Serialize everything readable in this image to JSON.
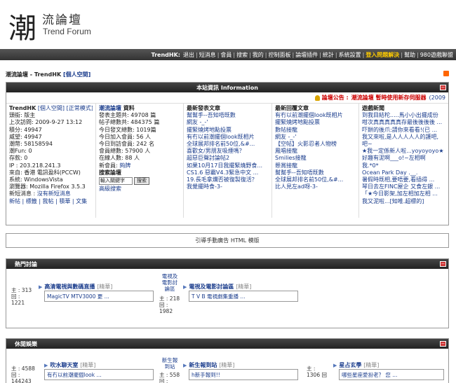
{
  "logo": {
    "glyph": "潮",
    "cn": "流論壇",
    "en": "Trend Forum"
  },
  "nav": {
    "items": [
      {
        "label": "TrendHK:",
        "style": "bold"
      },
      {
        "label": "退出"
      },
      {
        "label": "短消息"
      },
      {
        "label": "會員"
      },
      {
        "label": "搜索"
      },
      {
        "label": "我的"
      },
      {
        "label": "控制面板"
      },
      {
        "label": "論壇插件"
      },
      {
        "label": "統計"
      },
      {
        "label": "系統設置"
      },
      {
        "label": "登入問題解決",
        "style": "hl"
      },
      {
        "label": "幫助"
      },
      {
        "label": "980遊戲聯盟"
      }
    ]
  },
  "breadcrumb": {
    "site": "潮流論壇 - TrendHK",
    "link": "[個人空間]"
  },
  "info_box": {
    "title": "本站資訊 Information",
    "announce_label": "論壇公告 :",
    "announce_text": "潮流論壇 暫時使用新存伺服器",
    "announce_date": "(2009",
    "user": {
      "name": "TrendHK",
      "links": "[個人空間] [正常模式]",
      "lines": [
        "頭銜: 版主",
        "上次訪問: 2009-9-27 13:12",
        "積分: 49947",
        "威望: 49947",
        "潮幣: 58158594",
        "潮Fun: 0",
        "存款: 0",
        "IP : 203.218.241.3",
        "來自: 香港 電訊盈科(PCCW)",
        "系統: WindowsVista",
        "瀏覽器: Mozilla Firefox 3.5.3"
      ],
      "msg_label": "新短消息 :",
      "msg_link": "沒有新短消息",
      "bottom_links": "新帖 | 標籤 | 我帖 | 積華 | 文集"
    },
    "stats": {
      "title_link": "潮流論壇",
      "title_suffix": "資料",
      "lines": [
        "發表主題共: 49708 篇",
        "帖子總數共: 484375 篇",
        "今日發文總數: 1019篇",
        "今日加入會員: 56 人",
        "今日到訪會員: 242 名",
        "會員總數: 57900 人",
        "在線人數: 88 人"
      ],
      "newest_label": "新會員:",
      "newest_name": "夠牌",
      "search_title": "搜索論壇",
      "search_placeholder": "輸入關鍵字",
      "search_button": "搜索",
      "advanced": "高級搜索"
    },
    "new_posts": {
      "title": "最新發表文章",
      "items": [
        "幫幫手--吾知唔既數",
        "網友 -_-'",
        "擺緊燒烤地點投票",
        "有冇以前潮擺個look既相片",
        "全球展邦排名前50位,&#...",
        "喜歡女/男朋友吸煙嗎？",
        "超惡巨聲討論帖2",
        "如果10月17日我擺緊燒野食...",
        "CS1.6 惡霸V4.3緊急中文 ...",
        "19.長毛拿爛否被復製復活？",
        "我覺擺時食-3-"
      ]
    },
    "new_replies": {
      "title": "最新回覆文章",
      "items": [
        "有冇以前潮擺個look既相片",
        "擺緊燒烤地點投票",
        "數帖接龍",
        "網友 -_-'",
        "【空帖】火影忍者人物榜",
        "鳳唱接龍",
        "Smilies接龍",
        "懸賞接龍",
        "幫幫手--吾知唔既數",
        "全球展邦排名前50位,&#...",
        "比人見左ad呀-3-"
      ]
    },
    "news": {
      "title": "遊戲新聞",
      "items": [
        "到我目結柁.....馬小小出擺成份",
        "咁次真真真真真存最後後後後 ...",
        "吓餅的後爪:請你來看看!(已 ...",
        "我又來啦,是人人人人人的護吧,",
        "吧~",
        "★我一定係新人啦...yoyoyoyo★",
        "好趣有泥啊___o!~左相啊",
        "我.*0*",
        "Ocean Park Day .__.",
        "暑假時既相,要唔要,看插得 ...",
        "琴日去左FINC屋企 又食左銀 ...",
        "「★今日影架,加左相加左相 ...",
        "我又泥啦...[知唯.超標的]"
      ]
    }
  },
  "ad_text": "引導手動廣告 HTML 模版",
  "hot": {
    "title": "熱門討論",
    "forums": [
      {
        "stats": [
          "主 : 313",
          "回 :",
          "1221"
        ],
        "name": "高清電視與數碼直播",
        "tag": "[精華]",
        "last": "MagicTV MTV3000 更 ..."
      },
      {
        "side": [
          "電視及",
          "電影討",
          "論區"
        ],
        "stats": [
          "主 : 218",
          "回 :",
          "1982"
        ],
        "name": "電視及電影討論區",
        "tag": "[精華]",
        "last": "T V B 電視劇集重播 ..."
      }
    ]
  },
  "leisure": {
    "title": "休閒娛樂",
    "forums": [
      {
        "stats": [
          "主 : 4588",
          "回 :",
          "144243"
        ],
        "name": "吹水聊天室",
        "tag": "[精華]",
        "last": "有冇以前潮擺個look ..."
      },
      {
        "side": [
          "新生報",
          "到站"
        ],
        "stats": [
          "主 : 558",
          "回 :"
        ],
        "name": "新生報到站",
        "tag": "[精華]",
        "last": "h新手報到!!"
      },
      {
        "stats": [
          "主 :",
          "1306 回"
        ],
        "name": "星占玄學",
        "tag": "[精華]",
        "last": "哪些星座愛扮老？ 您 ..."
      }
    ]
  }
}
